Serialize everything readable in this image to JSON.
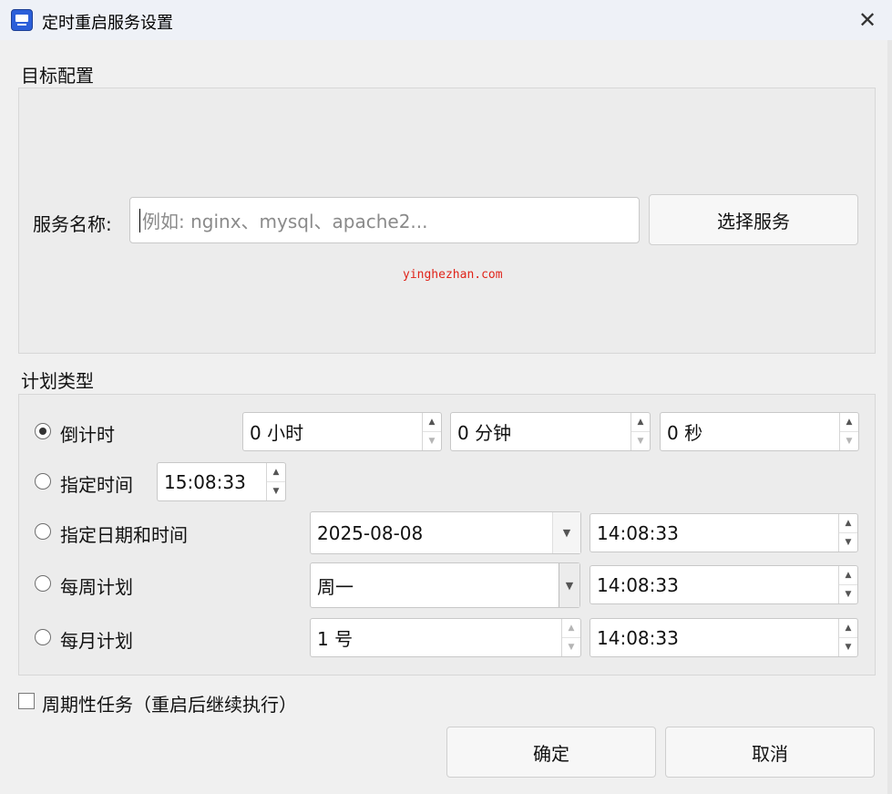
{
  "window": {
    "title": "定时重启服务设置",
    "close_icon": "close-icon"
  },
  "target": {
    "section_title": "目标配置",
    "service_label": "服务名称:",
    "service_value": "",
    "service_placeholder": "例如: nginx、mysql、apache2...",
    "choose_button": "选择服务",
    "watermark": "yinghezhan.com"
  },
  "schedule": {
    "section_title": "计划类型",
    "countdown": {
      "label": "倒计时",
      "selected": true,
      "hours": "0 小时",
      "minutes": "0 分钟",
      "seconds": "0 秒"
    },
    "specific_time": {
      "label": "指定时间",
      "selected": false,
      "time": "15:08:33"
    },
    "specific_datetime": {
      "label": "指定日期和时间",
      "selected": false,
      "date": "2025-08-08",
      "time": "14:08:33"
    },
    "weekly": {
      "label": "每周计划",
      "selected": false,
      "day": "周一",
      "time": "14:08:33"
    },
    "monthly": {
      "label": "每月计划",
      "selected": false,
      "day": "1 号",
      "time": "14:08:33"
    }
  },
  "periodic": {
    "label": "周期性任务（重启后继续执行）",
    "checked": false
  },
  "buttons": {
    "ok": "确定",
    "cancel": "取消"
  }
}
